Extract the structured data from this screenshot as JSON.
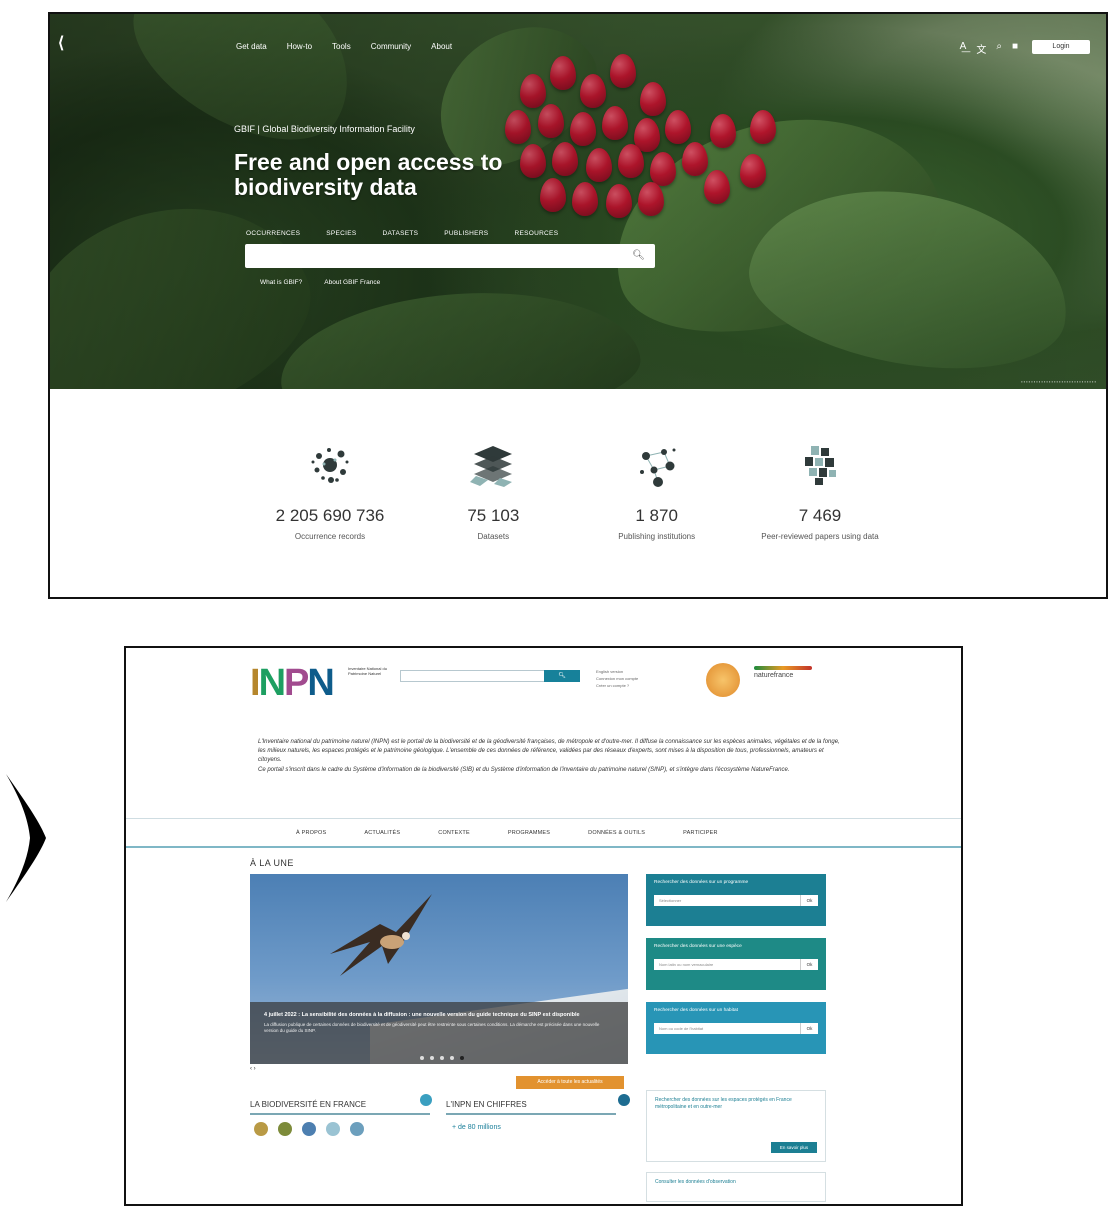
{
  "gbif": {
    "nav": [
      "Get data",
      "How-to",
      "Tools",
      "Community",
      "About"
    ],
    "login": "Login",
    "subtitle": "GBIF | Global Biodiversity Information Facility",
    "title": "Free and open access to biodiversity data",
    "tabs": [
      "OCCURRENCES",
      "SPECIES",
      "DATASETS",
      "PUBLISHERS",
      "RESOURCES"
    ],
    "search_placeholder": "",
    "links": [
      "What is GBIF?",
      "About GBIF France"
    ],
    "stats": [
      {
        "value": "2 205 690 736",
        "label": "Occurrence records"
      },
      {
        "value": "75 103",
        "label": "Datasets"
      },
      {
        "value": "1 870",
        "label": "Publishing institutions"
      },
      {
        "value": "7 469",
        "label": "Peer-reviewed papers using data"
      }
    ],
    "icon_color": "#2f3a3a"
  },
  "inpn": {
    "logo_text": "Inventaire National du Patrimoine Naturel",
    "user_links": [
      "English version",
      "Connexion mon compte",
      "Créer un compte ?"
    ],
    "partner": "naturefrance",
    "intro": [
      "L'Inventaire national du patrimoine naturel (INPN) est le portail de la biodiversité et de la géodiversité françaises, de métropole et d'outre-mer. Il diffuse la connaissance sur les espèces animales, végétales et de la fonge, les milieux naturels, les espaces protégés et le patrimoine géologique. L'ensemble de ces données de référence, validées par des réseaux d'experts, sont mises à la disposition de tous, professionnels, amateurs et citoyens.",
      "Ce portail s'inscrit dans le cadre du Système d'information de la biodiversité (SIB) et du Système d'information de l'inventaire du patrimoine naturel (SINP), et s'intègre dans l'écosystème NatureFrance."
    ],
    "nav": [
      "À PROPOS",
      "ACTUALITÉS",
      "CONTEXTE",
      "PROGRAMMES",
      "DONNÉES & OUTILS",
      "PARTICIPER"
    ],
    "une": "À LA UNE",
    "carousel": {
      "title": "4 juillet 2022 : La sensibilité des données à la diffusion : une nouvelle version du guide technique du SINP est disponible",
      "text": "La diffusion publique de certaines données de biodiversité et de géodiversité peut être restreinte sous certaines conditions. La démarche est précisée dans une nouvelle version du guide du SINP.",
      "arrows": "‹ ›"
    },
    "all_news": "Accéder à toute les actualités",
    "sec_biodiv": "LA BIODIVERSITÉ EN FRANCE",
    "sec_chiffres": "L'INPN EN CHIFFRES",
    "chiffre_first": "+ de 80 millions",
    "side": [
      {
        "title": "Rechercher des données sur un programme",
        "input": "Sélectionner",
        "ok": "Ok"
      },
      {
        "title": "Rechercher des données sur une espèce",
        "input": "Nom latin ou nom vernaculaire",
        "ok": "Ok"
      },
      {
        "title": "Rechercher des données sur un habitat",
        "input": "Nom ou code de l'habitat",
        "ok": "Ok"
      }
    ],
    "side_white": {
      "title": "Rechercher des données sur les espaces protégés en France métropolitaine et en outre-mer",
      "button": "En savoir plus"
    },
    "side_bottom": "Consulter les données d'observation"
  }
}
